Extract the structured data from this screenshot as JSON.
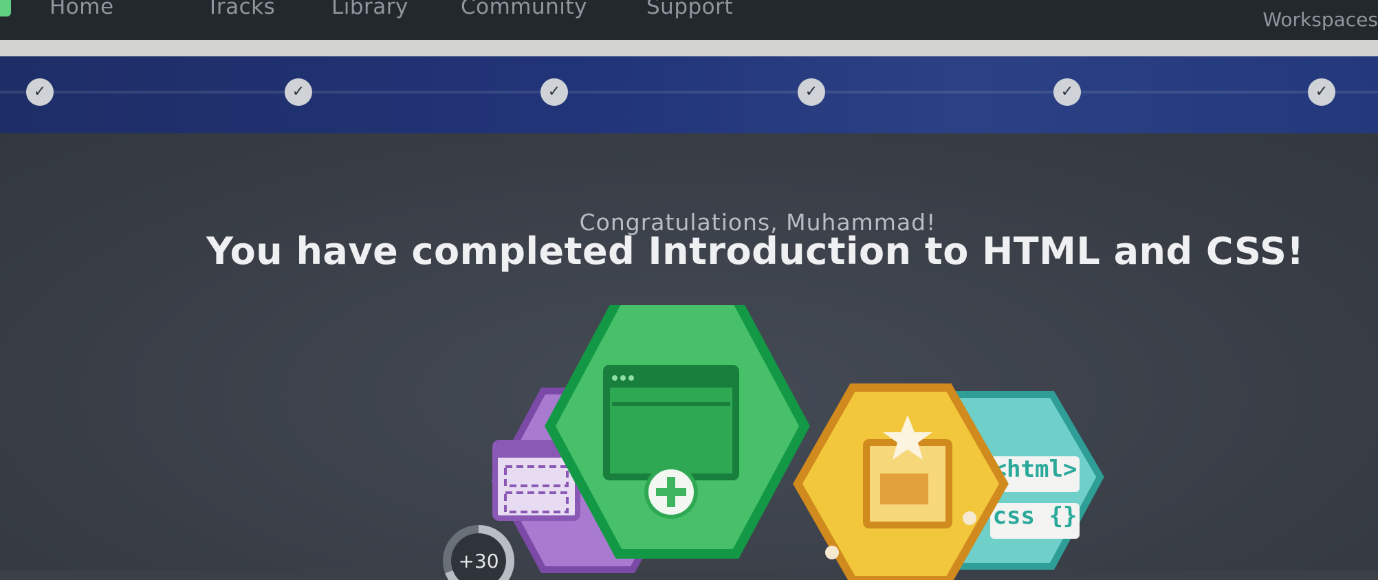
{
  "nav": {
    "items": [
      "Home",
      "Tracks",
      "Library",
      "Community",
      "Support"
    ],
    "workspace_label": "Workspaces"
  },
  "progress": {
    "steps_completed": 6,
    "steps_total": 6,
    "check_glyph": "✓"
  },
  "completion": {
    "greeting": "Congratulations, Muhammad!",
    "headline": "You have completed Introduction to HTML and CSS!"
  },
  "badges": {
    "points_label": "+30",
    "html_tag_text": "<html>",
    "css_text": "css {}",
    "icons": [
      "layout-grid-icon",
      "add-window-icon",
      "image-star-icon",
      "code-tags-icon"
    ]
  },
  "colors": {
    "nav_bg": "#23282d",
    "progress_band": "#22357a",
    "page_bg": "#3b4048",
    "badge_purple": "#a97bd0",
    "badge_green": "#48c069",
    "badge_yellow": "#f2c73c",
    "badge_teal": "#6fcfc9"
  }
}
